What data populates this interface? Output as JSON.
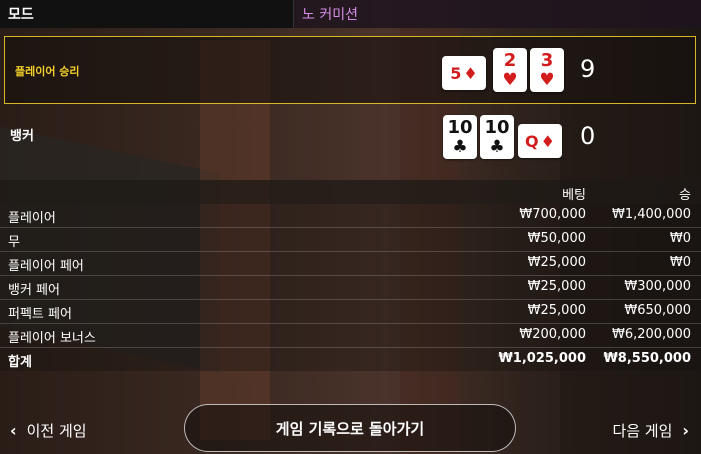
{
  "header": {
    "mode_label": "모드",
    "mode_value": "노 커미션"
  },
  "hands": {
    "player": {
      "label": "플레이어 승리",
      "score": "9",
      "cards": [
        {
          "rank": "5",
          "suit": "♦",
          "side": true,
          "color": "red"
        },
        {
          "rank": "2",
          "suit": "♥",
          "side": false,
          "color": "red"
        },
        {
          "rank": "3",
          "suit": "♥",
          "side": false,
          "color": "red"
        }
      ]
    },
    "banker": {
      "label": "뱅커",
      "score": "0",
      "cards": [
        {
          "rank": "10",
          "suit": "♣",
          "side": false,
          "color": "black"
        },
        {
          "rank": "10",
          "suit": "♣",
          "side": false,
          "color": "black"
        },
        {
          "rank": "Q",
          "suit": "♦",
          "side": true,
          "color": "red"
        }
      ]
    }
  },
  "table": {
    "headers": {
      "bet": "베팅",
      "win": "승"
    },
    "rows": [
      {
        "name": "플레이어",
        "bet": "₩700,000",
        "win": "₩1,400,000"
      },
      {
        "name": "무",
        "bet": "₩50,000",
        "win": "₩0"
      },
      {
        "name": "플레이어 페어",
        "bet": "₩25,000",
        "win": "₩0"
      },
      {
        "name": "뱅커 페어",
        "bet": "₩25,000",
        "win": "₩300,000"
      },
      {
        "name": "퍼펙트 페어",
        "bet": "₩25,000",
        "win": "₩650,000"
      },
      {
        "name": "플레이어 보너스",
        "bet": "₩200,000",
        "win": "₩6,200,000"
      }
    ],
    "total": {
      "name": "합계",
      "bet": "₩1,025,000",
      "win": "₩8,550,000"
    }
  },
  "footer": {
    "prev_label": "이전 게임",
    "back_label": "게임 기록으로 돌아가기",
    "next_label": "다음 게임"
  },
  "colors": {
    "player_highlight": "#f3cf2b",
    "mode_value": "#d68ce8",
    "card_red": "#d31c1c"
  },
  "icons": {
    "prev": "chevron-left-icon",
    "next": "chevron-right-icon"
  }
}
